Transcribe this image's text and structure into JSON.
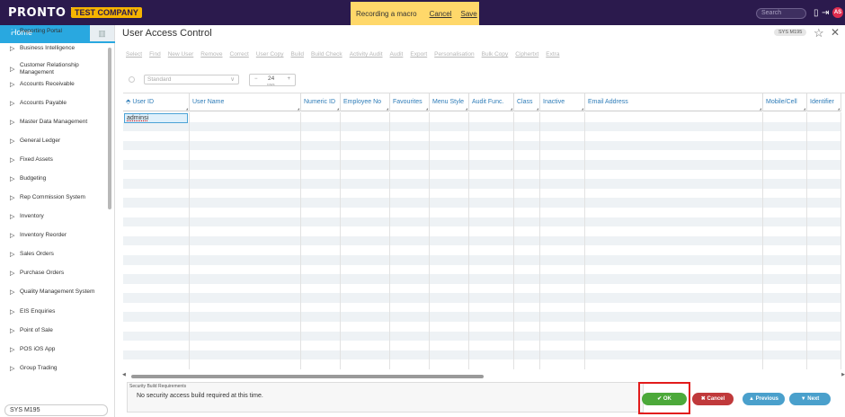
{
  "topbar": {
    "logo": "PRONTO Xi",
    "company": "TEST COMPANY",
    "macro": {
      "title": "Recording a macro",
      "cancel": "Cancel",
      "save": "Save"
    },
    "search_placeholder": "Search",
    "avatar": "AS",
    "icons": [
      "panel-icon",
      "logout-icon"
    ]
  },
  "sidebar": {
    "home_label": "Home",
    "items": [
      {
        "label": "Reporting Portal",
        "type": "dot"
      },
      {
        "label": "Business Intelligence",
        "type": "tri"
      },
      {
        "label": "Customer Relationship Management",
        "type": "tri"
      },
      {
        "label": "Accounts Receivable",
        "type": "tri"
      },
      {
        "label": "Accounts Payable",
        "type": "tri"
      },
      {
        "label": "Master Data Management",
        "type": "tri"
      },
      {
        "label": "General Ledger",
        "type": "tri"
      },
      {
        "label": "Fixed Assets",
        "type": "tri"
      },
      {
        "label": "Budgeting",
        "type": "tri"
      },
      {
        "label": "Rep Commission System",
        "type": "tri"
      },
      {
        "label": "Inventory",
        "type": "tri"
      },
      {
        "label": "Inventory Reorder",
        "type": "tri"
      },
      {
        "label": "Sales Orders",
        "type": "tri"
      },
      {
        "label": "Purchase Orders",
        "type": "tri"
      },
      {
        "label": "Quality Management System",
        "type": "tri"
      },
      {
        "label": "EIS Enquiries",
        "type": "tri"
      },
      {
        "label": "Point of Sale",
        "type": "tri"
      },
      {
        "label": "POS iOS App",
        "type": "tri"
      },
      {
        "label": "Group Trading",
        "type": "tri"
      }
    ],
    "footer_input": "SYS M195"
  },
  "main": {
    "title": "User Access Control",
    "chip": "SYS M195",
    "toolbar": [
      "Select",
      "Find",
      "New User",
      "Remove",
      "Correct",
      "User Copy",
      "Build",
      "Build Check",
      "Activity Audit",
      "Audit",
      "Export",
      "Personalisation",
      "Bulk Copy",
      "Ciphertxt",
      "Extra"
    ],
    "view_select": "Standard",
    "rows_value": "24",
    "rows_unit": "rows",
    "columns": [
      "User ID",
      "User Name",
      "Numeric ID",
      "Employee No",
      "Favourites",
      "Menu Style",
      "Audit Func.",
      "Class",
      "Inactive",
      "Email Address",
      "Mobile/Cell",
      "Identifier"
    ],
    "row_count": 27,
    "edit_value": "adminsi",
    "security_label": "Security Build Requirements",
    "security_msg": "No security access build required at this time.",
    "buttons": {
      "ok": "OK",
      "cancel": "Cancel",
      "previous": "Previous",
      "next": "Next"
    }
  }
}
